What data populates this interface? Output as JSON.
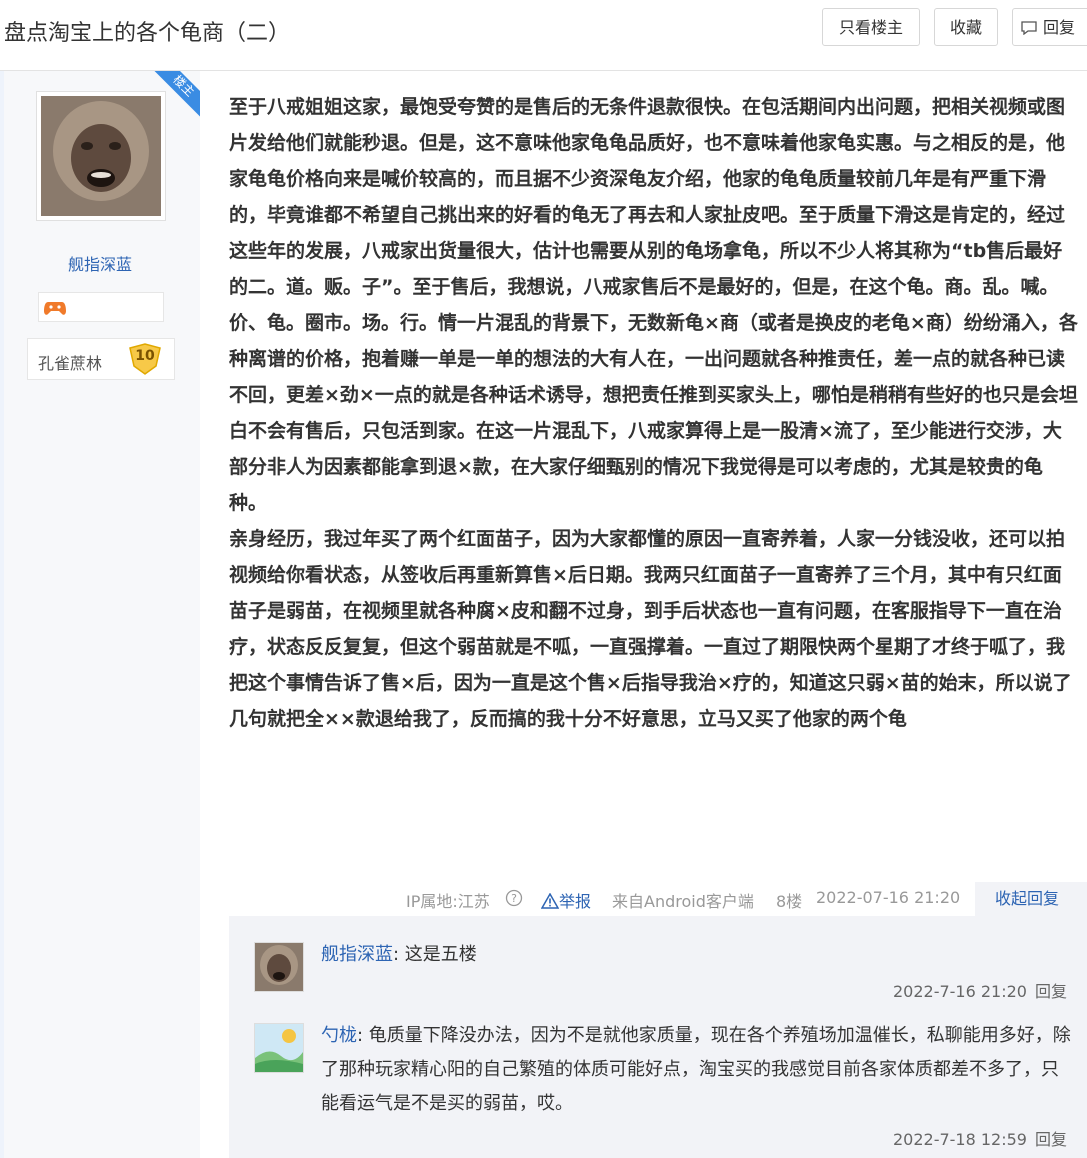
{
  "header": {
    "title": "盘点淘宝上的各个龟商（二）",
    "only_owner_label": "只看楼主",
    "favorite_label": "收藏",
    "reply_label": "回复"
  },
  "author": {
    "name": "舰指深蓝",
    "owner_tag": "楼主",
    "level_name": "孔雀蔗林",
    "level": "10"
  },
  "post": {
    "paragraphs": [
      "至于八戒姐姐这家，最饱受夸赞的是售后的无条件退款很快。在包活期间内出问题，把相关视频或图片发给他们就能秒退。但是，这不意味他家龟龟品质好，也不意味着他家龟实惠。与之相反的是，他家龟龟价格向来是喊价较高的，而且据不少资深龟友介绍，他家的龟龟质量较前几年是有严重下滑的，毕竟谁都不希望自己挑出来的好看的龟无了再去和人家扯皮吧。至于质量下滑这是肯定的，经过这些年的发展，八戒家出货量很大，估计也需要从别的龟场拿龟，所以不少人将其称为“tb售后最好的二。道。贩。子”。至于售后，我想说，八戒家售后不是最好的，但是，在这个龟。商。乱。喊。价、龟。圈市。场。行。情一片混乱的背景下，无数新龟×商（或者是换皮的老龟×商）纷纷涌入，各种离谱的价格，抱着赚一单是一单的想法的大有人在，一出问题就各种推责任，差一点的就各种已读不回，更差×劲×一点的就是各种话术诱导，想把责任推到买家头上，哪怕是稍稍有些好的也只是会坦白不会有售后，只包活到家。在这一片混乱下，八戒家算得上是一股清×流了，至少能进行交涉，大部分非人为因素都能拿到退×款，在大家仔细甄别的情况下我觉得是可以考虑的，尤其是较贵的龟种。",
      "亲身经历，我过年买了两个红面苗子，因为大家都懂的原因一直寄养着，人家一分钱没收，还可以拍视频给你看状态，从签收后再重新算售×后日期。我两只红面苗子一直寄养了三个月，其中有只红面苗子是弱苗，在视频里就各种腐×皮和翻不过身，到手后状态也一直有问题，在客服指导下一直在治疗，状态反反复复，但这个弱苗就是不呱，一直强撑着。一直过了期限快两个星期了才终于呱了，我把这个事情告诉了售×后，因为一直是这个售×后指导我治×疗的，知道这只弱×苗的始末，所以说了几句就把全××款退给我了，反而搞的我十分不好意思，立马又买了他家的两个龟"
    ]
  },
  "footer": {
    "ip": "IP属地:江苏",
    "report": "举报",
    "source": "来自Android客户端",
    "floor": "8楼",
    "time": "2022-07-16 21:20",
    "collapse": "收起回复"
  },
  "comments": [
    {
      "user": "舰指深蓝",
      "text": "这是五楼",
      "time": "2022-7-16 21:20",
      "reply": "回复"
    },
    {
      "user": "勺栊",
      "text": "龟质量下降没办法，因为不是就他家质量，现在各个养殖场加温催长，私聊能用多好，除了那种玩家精心阳的自己繁殖的体质可能好点，淘宝买的我感觉目前各家体质都差不多了，只能看运气是不是买的弱苗，哎。",
      "time": "2022-7-18 12:59",
      "reply": "回复"
    }
  ],
  "colors": {
    "link": "#2d64b3",
    "owner_ribbon": "#3a8ce3",
    "comment_bg": "#f2f3f7",
    "sidebar_bg": "#f7f8fa"
  }
}
